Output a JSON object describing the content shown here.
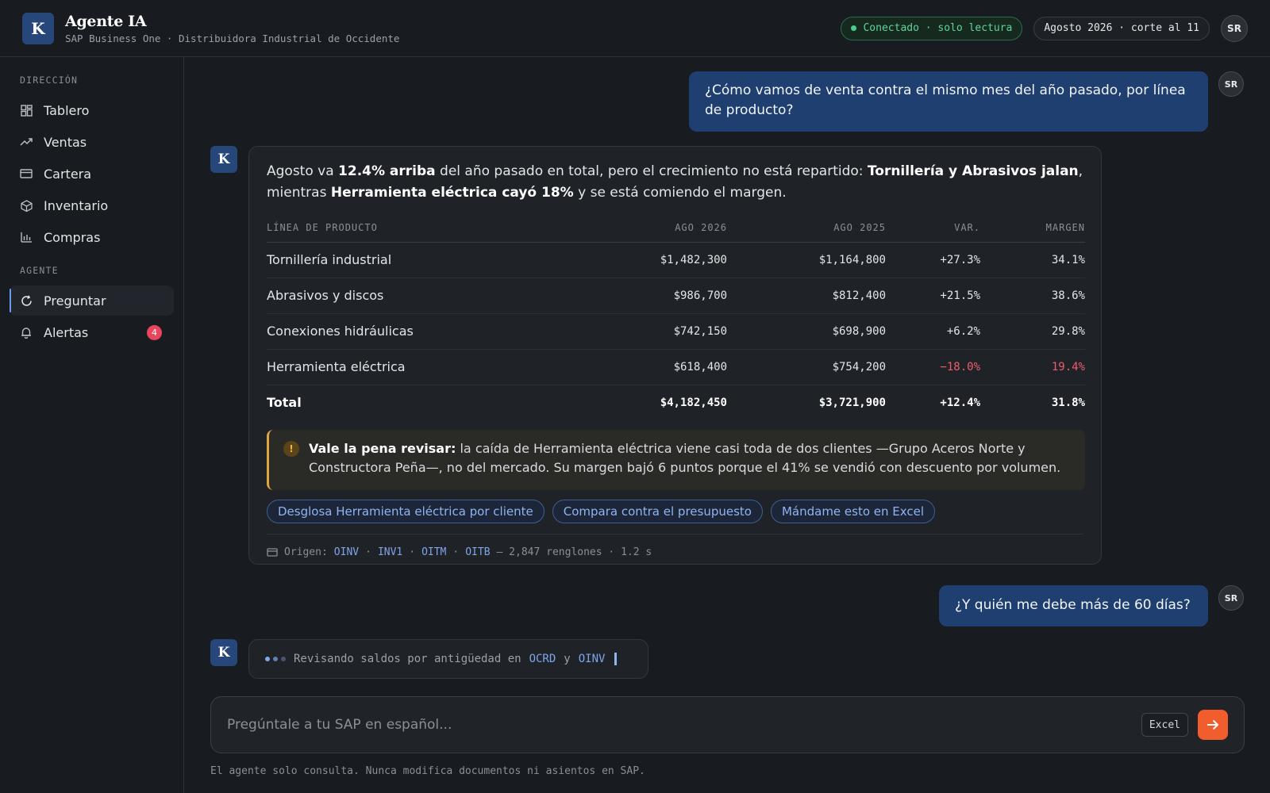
{
  "header": {
    "logo_letter": "K",
    "title": "Agente IA",
    "subtitle": "SAP Business One · Distribuidora Industrial de Occidente",
    "status": "Conectado · solo lectura",
    "period": "Agosto 2026 · corte al 11",
    "user_initials": "SR"
  },
  "sidebar": {
    "section_direccion": "DIRECCIÓN",
    "items": [
      {
        "label": "Tablero",
        "icon": "grid-icon"
      },
      {
        "label": "Ventas",
        "icon": "trend-icon"
      },
      {
        "label": "Cartera",
        "icon": "card-icon"
      },
      {
        "label": "Inventario",
        "icon": "box-icon"
      },
      {
        "label": "Compras",
        "icon": "bar-chart-icon"
      }
    ],
    "section_agente": "AGENTE",
    "agent_items": [
      {
        "label": "Preguntar",
        "icon": "refresh-icon",
        "active": true
      },
      {
        "label": "Alertas",
        "icon": "bell-icon",
        "badge": "4"
      }
    ]
  },
  "conversation": {
    "user_q1": "¿Cómo vamos de venta contra el mismo mes del año pasado, por línea de producto?",
    "bot_letter": "K",
    "answer": {
      "p1": "Agosto va ",
      "b1": "12.4% arriba",
      "p2": " del año pasado en total, pero el crecimiento no está repartido: ",
      "b2": "Tornillería y Abrasivos jalan",
      "p3": ", mientras ",
      "b3": "Herramienta eléctrica cayó 18%",
      "p4": " y se está comiendo el margen."
    },
    "table": {
      "headers": [
        "LÍNEA DE PRODUCTO",
        "AGO 2026",
        "AGO 2025",
        "VAR.",
        "MARGEN"
      ],
      "rows": [
        [
          "Tornillería industrial",
          "$1,482,300",
          "$1,164,800",
          "+27.3%",
          "34.1%"
        ],
        [
          "Abrasivos y discos",
          "$986,700",
          "$812,400",
          "+21.5%",
          "38.6%"
        ],
        [
          "Conexiones hidráulicas",
          "$742,150",
          "$698,900",
          "+6.2%",
          "29.8%"
        ],
        [
          "Herramienta eléctrica",
          "$618,400",
          "$754,200",
          "−18.0%",
          "19.4%"
        ]
      ],
      "total": [
        "Total",
        "$4,182,450",
        "$3,721,900",
        "+12.4%",
        "31.8%"
      ]
    },
    "callout": {
      "icon": "!",
      "title": "Vale la pena revisar:",
      "text": " la caída de Herramienta eléctrica viene casi toda de dos clientes —Grupo Aceros Norte y Constructora Peña—, no del mercado. Su margen bajó 6 puntos porque el 41% se vendió con descuento por volumen."
    },
    "chips": [
      "Desglosa Herramienta eléctrica por cliente",
      "Compara contra el presupuesto",
      "Mándame esto en Excel"
    ],
    "source": {
      "label": "Origen:",
      "tables": [
        "OINV",
        "INV1",
        "OITM",
        "OITB"
      ],
      "sep": "·",
      "meta": "— 2,847 renglones · 1.2 s"
    },
    "user_q2": "¿Y quién me debe más de 60 días?",
    "typing": {
      "text1": "Revisando saldos por antigüedad en",
      "t1": "OCRD",
      "and": "y",
      "t2": "OINV"
    }
  },
  "composer": {
    "placeholder": "Pregúntale a tu SAP en español...",
    "excel_label": "Excel"
  },
  "footnote": "El agente solo consulta. Nunca modifica documentos ni asientos en SAP.",
  "colors": {
    "accent": "#27467a",
    "send": "#f25d2e",
    "positive": "#45d08c",
    "negative": "#ef5d6d",
    "warning": "#e0a63c"
  }
}
